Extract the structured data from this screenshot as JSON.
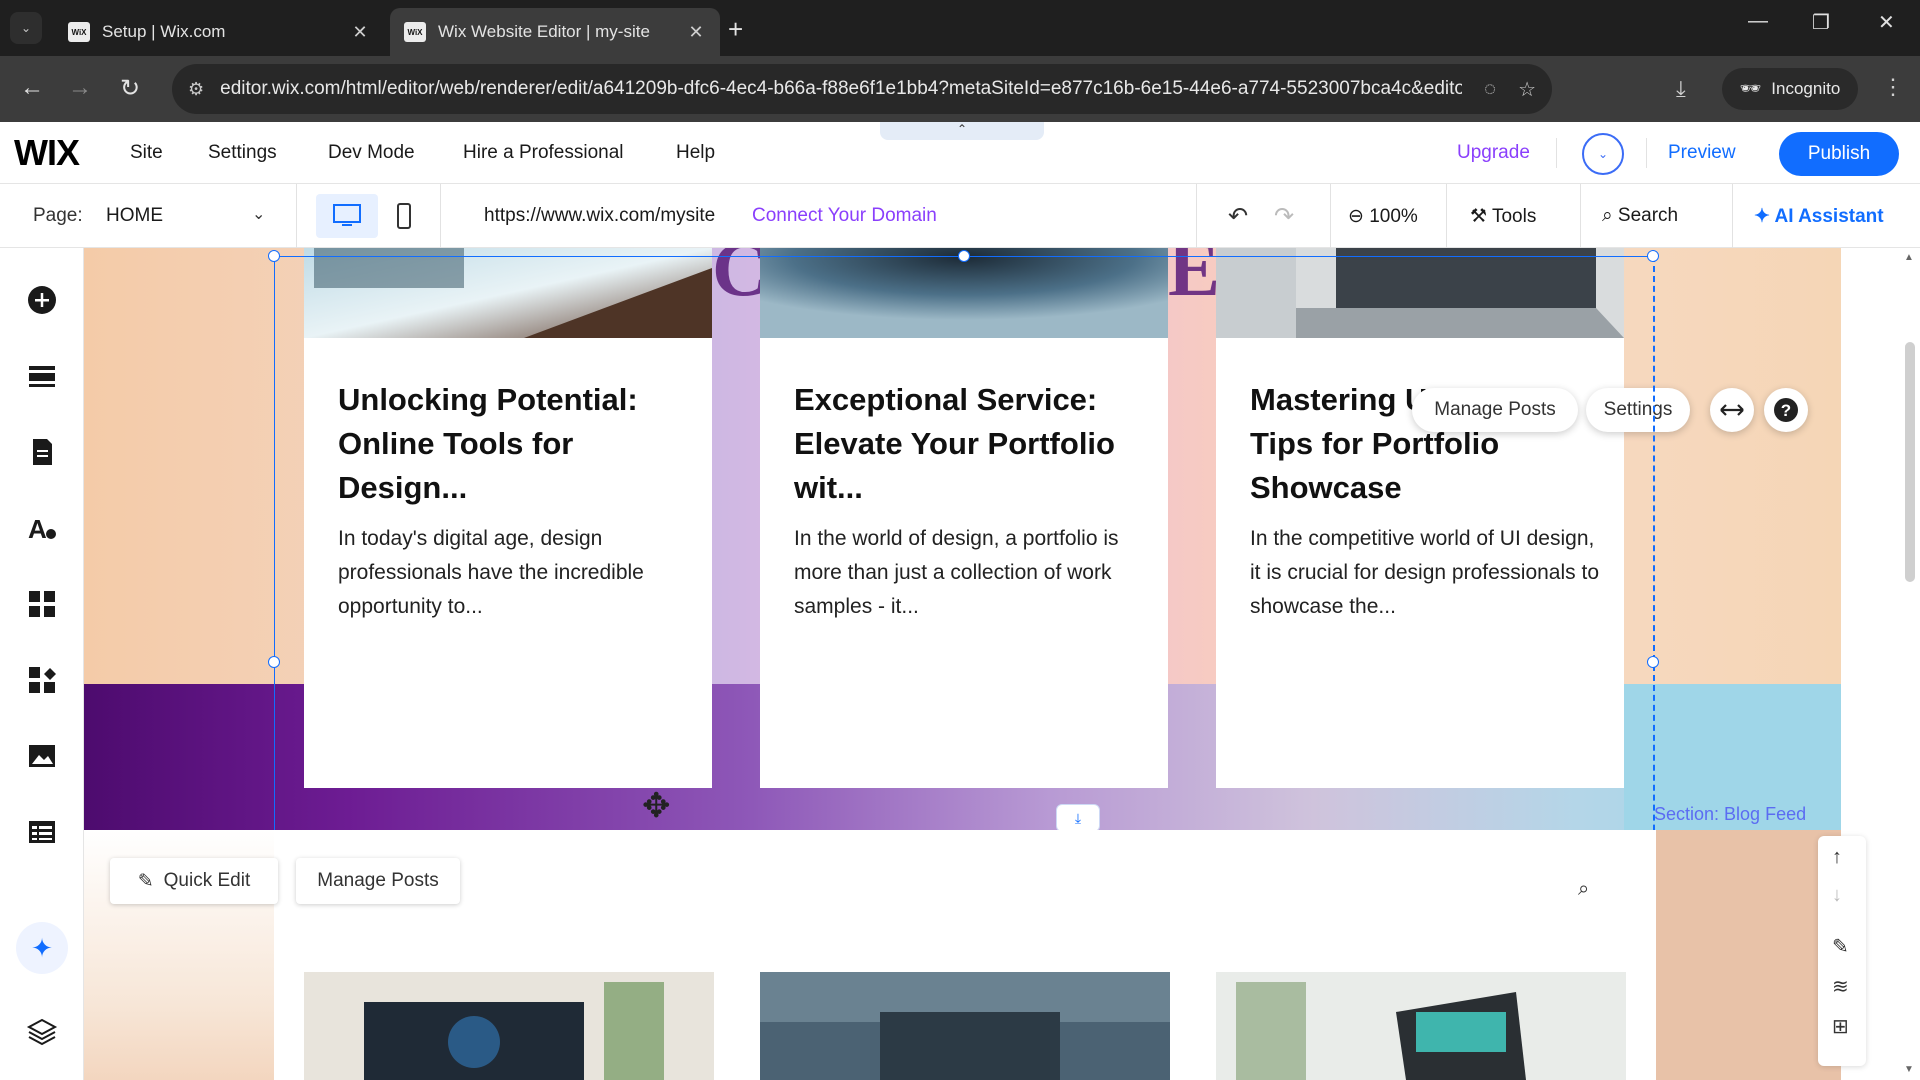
{
  "browser": {
    "tabs": [
      {
        "title": "Setup | Wix.com",
        "favicon": "WiX"
      },
      {
        "title": "Wix Website Editor | my-site",
        "favicon": "WiX"
      }
    ],
    "url": "editor.wix.com/html/editor/web/renderer/edit/a641209b-dfc6-4ec4-b66a-f88e6f1e1bb4?metaSiteId=e877c16b-6e15-44e6-a774-5523007bca4c&edito...",
    "incognito_label": "Incognito"
  },
  "wix_top": {
    "logo": "WIX",
    "menu": [
      "Site",
      "Settings",
      "Dev Mode",
      "Hire a Professional",
      "Help"
    ],
    "upgrade": "Upgrade",
    "preview": "Preview",
    "publish": "Publish"
  },
  "wix_toolbar": {
    "page_label": "Page:",
    "page_value": "HOME",
    "site_url": "https://www.wix.com/mysite",
    "connect_domain": "Connect Your Domain",
    "zoom": "100%",
    "tools": "Tools",
    "search": "Search",
    "ai_assistant": "AI Assistant"
  },
  "blog": {
    "posts": [
      {
        "title": "Unlocking Potential: Online Tools for Design...",
        "excerpt": "In today's digital age, design professionals have the incredible opportunity to..."
      },
      {
        "title": "Exceptional Service: Elevate Your Portfolio wit...",
        "excerpt": "In the world of design, a portfolio is more than just a collection of work samples - it..."
      },
      {
        "title": "Mastering UI Design: Tips for Portfolio Showcase",
        "excerpt": "In the competitive world of UI design, it is crucial for design professionals to showcase the..."
      }
    ],
    "floating": {
      "manage_posts": "Manage Posts",
      "settings": "Settings"
    },
    "section_label": "Section: Blog Feed"
  },
  "lower": {
    "quick_edit": "Quick Edit",
    "manage_posts": "Manage Posts"
  },
  "colors": {
    "wix_blue": "#116dff",
    "accent_purple": "#8a3ffc"
  }
}
